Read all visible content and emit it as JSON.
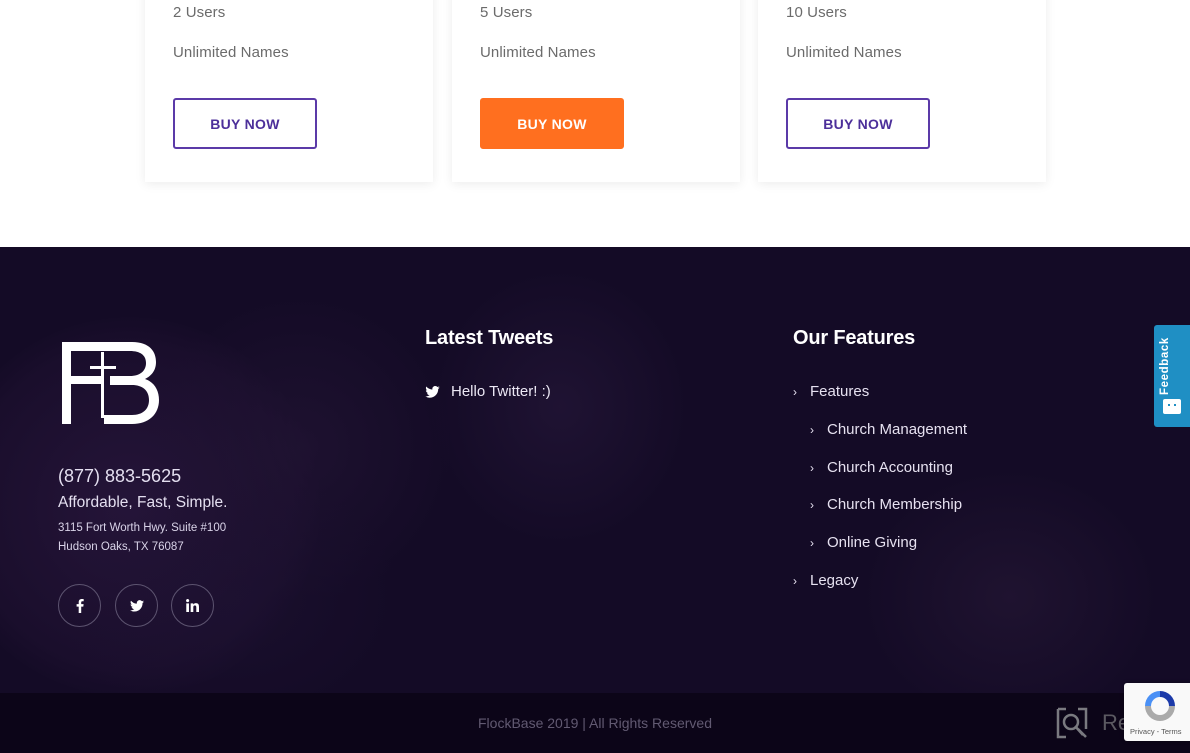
{
  "pricing": {
    "plans": [
      {
        "users": "2 Users",
        "names": "Unlimited Names",
        "button": "BUY NOW",
        "highlighted": false
      },
      {
        "users": "5 Users",
        "names": "Unlimited Names",
        "button": "BUY NOW",
        "highlighted": true
      },
      {
        "users": "10 Users",
        "names": "Unlimited Names",
        "button": "BUY NOW",
        "highlighted": false
      }
    ]
  },
  "footer": {
    "logo_text": "FB",
    "phone": "(877) 883-5625",
    "tagline": "Affordable, Fast, Simple.",
    "address_line1": "3115 Fort Worth Hwy. Suite #100",
    "address_line2": "Hudson Oaks, TX 76087",
    "social": [
      {
        "name": "facebook",
        "icon": "facebook-icon"
      },
      {
        "name": "twitter",
        "icon": "twitter-icon"
      },
      {
        "name": "linkedin",
        "icon": "linkedin-icon"
      }
    ],
    "tweets": {
      "title": "Latest Tweets",
      "items": [
        "Hello Twitter! :)"
      ]
    },
    "features": {
      "title": "Our Features",
      "items": [
        {
          "label": "Features",
          "level": 0
        },
        {
          "label": "Church Management",
          "level": 1
        },
        {
          "label": "Church Accounting",
          "level": 1
        },
        {
          "label": "Church Membership",
          "level": 1
        },
        {
          "label": "Online Giving",
          "level": 1
        },
        {
          "label": "Legacy",
          "level": 0
        }
      ]
    },
    "copyright": "FlockBase 2019 | All Rights Reserved"
  },
  "feedback": {
    "label": "Feedback"
  },
  "recaptcha": {
    "text": "Privacy - Terms"
  },
  "watermark": {
    "text": "Revain"
  },
  "colors": {
    "accent_orange": "#ff6f1f",
    "accent_purple": "#5b3aa8",
    "footer_bg": "#140b26",
    "feedback_blue": "#1f8fc4"
  }
}
